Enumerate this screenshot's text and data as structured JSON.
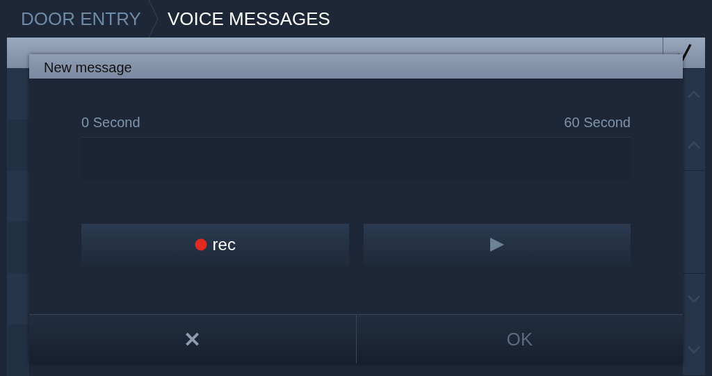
{
  "breadcrumb": [
    {
      "label": "DOOR ENTRY",
      "selected": false
    },
    {
      "label": "VOICE MESSAGES",
      "selected": true
    }
  ],
  "dialog": {
    "title": "New message",
    "timeline": {
      "start": "0 Second",
      "end": "60 Second"
    },
    "record_button": {
      "label": "rec"
    },
    "cancel_button": {
      "label": "✕"
    },
    "ok_button": {
      "label": "OK",
      "disabled": true
    }
  }
}
